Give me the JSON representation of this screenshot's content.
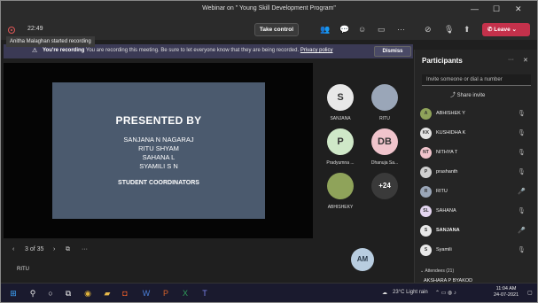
{
  "window": {
    "title": "Webinar on \" Young Skill Development Program\"",
    "minimize": "—",
    "maximize": "☐",
    "close": "✕"
  },
  "toolbar": {
    "timer": "22:49",
    "take_control": "Take control",
    "leave": "Leave"
  },
  "tooltip": "Anitha Malaghan started recording",
  "banner": {
    "bold": "You're recording",
    "text": "You are recording this meeting. Be sure to let everyone know that they are being recorded.",
    "link": "Privacy policy",
    "dismiss": "Dismiss"
  },
  "slide": {
    "heading": "PRESENTED BY",
    "names": [
      "SANJANA N NAGARAJ",
      "RITU SHYAM",
      "SAHANA L",
      "SYAMILI S N"
    ],
    "footer": "STUDENT COORDINATORS"
  },
  "pagebar": {
    "page": "3 of 35",
    "more": "···"
  },
  "presenter_name": "RITU",
  "tiles": [
    {
      "initials": "S",
      "label": "SANJANA",
      "color": "#e8e8e8"
    },
    {
      "initials": "",
      "label": "RITU",
      "color": "#9aa6b8"
    },
    {
      "initials": "P",
      "label": "Pradyumna ...",
      "color": "#cfe8c8"
    },
    {
      "initials": "DB",
      "label": "Dhanuja Sa...",
      "color": "#f0c4cc"
    },
    {
      "initials": "",
      "label": "ABHISHEKY",
      "color": "#8fa35a"
    },
    {
      "initials": "+24",
      "label": "",
      "color": "#3a3a3a"
    }
  ],
  "am_avatar": "AM",
  "panel": {
    "title": "Participants",
    "search_placeholder": "Invite someone or dial a number",
    "share_invite": "Share invite",
    "participants": [
      {
        "initials": "A",
        "name": "ABHISHEK Y",
        "color": "#8fa35a"
      },
      {
        "initials": "KK",
        "name": "KUSHIDHA K",
        "color": "#e4e4e4"
      },
      {
        "initials": "NT",
        "name": "NITHYA T",
        "color": "#f0c4cc"
      },
      {
        "initials": "P",
        "name": "prashanth",
        "color": "#d0d0d0"
      },
      {
        "initials": "R",
        "name": "RITU",
        "color": "#9aa6b8"
      },
      {
        "initials": "SL",
        "name": "SAHANA",
        "color": "#e4d6f0"
      },
      {
        "initials": "S",
        "name": "SANJANA",
        "color": "#e8e8e8"
      },
      {
        "initials": "S",
        "name": "Syamili",
        "color": "#e8e8e8"
      }
    ],
    "attendees": "Attendees (21)",
    "last_row": "AKSHARA P BYAKOD"
  },
  "taskbar": {
    "weather": "23°C Light rain",
    "time": "11:04 AM",
    "date": "24-07-2021"
  }
}
